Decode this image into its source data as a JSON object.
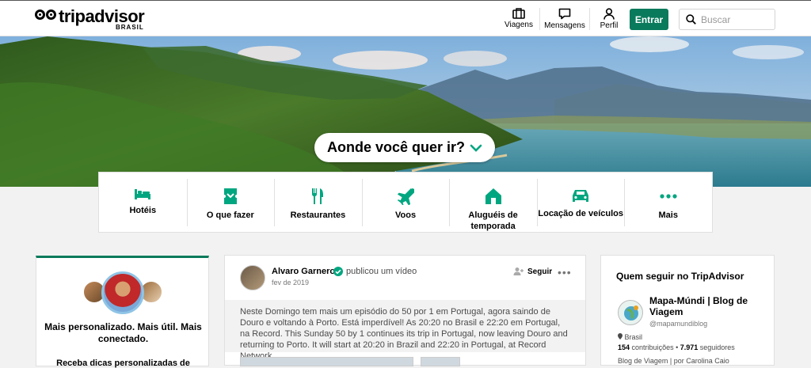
{
  "header": {
    "logo_text": "tripadvisor",
    "logo_sub": "BRASIL",
    "nav": [
      {
        "label": "Viagens",
        "icon": "suitcase-icon"
      },
      {
        "label": "Mensagens",
        "icon": "chat-icon"
      },
      {
        "label": "Perfil",
        "icon": "person-icon"
      }
    ],
    "login_label": "Entrar",
    "search_placeholder": "Buscar"
  },
  "hero": {
    "search_prompt": "Aonde você quer ir?"
  },
  "categories": [
    {
      "label": "Hotéis",
      "icon": "bed-icon"
    },
    {
      "label": "O que fazer",
      "icon": "ticket-icon"
    },
    {
      "label": "Restaurantes",
      "icon": "fork-knife-icon"
    },
    {
      "label": "Voos",
      "icon": "plane-icon"
    },
    {
      "label": "Aluguéis de temporada",
      "icon": "house-icon"
    },
    {
      "label": "Locação de veículos",
      "icon": "car-icon"
    },
    {
      "label": "Mais",
      "icon": "more-dots-icon"
    }
  ],
  "personalize_card": {
    "title": "Mais personalizado. Mais útil. Mais conectado.",
    "subtitle": "Receba dicas personalizadas de"
  },
  "post": {
    "author": "Alvaro Garnero",
    "action": "publicou um vídeo",
    "date": "fev de 2019",
    "follow_label": "Seguir",
    "text": "Neste Domingo tem mais um episódio do 50 por 1 em Portugal, agora saindo de Douro e voltando à Porto. Está imperdível! As 20:20 no Brasil e 22:20 em Portugal, na Record. This Sunday 50 by 1 continues its trip in Portugal, now leaving Douro and returning to Porto. It will start at 20:20 in Brazil and 22:20 in Portugal, at Record Network."
  },
  "follow_card": {
    "title": "Quem seguir no TripAdvisor",
    "rec_name": "Mapa-Múndi | Blog de Viagem",
    "rec_handle": "@mapamundiblog",
    "rec_location": "Brasil",
    "rec_contributions": "154",
    "rec_contributions_label": "contribuições",
    "rec_followers": "7.971",
    "rec_followers_label": "seguidores",
    "rec_desc": "Blog de Viagem | por Carolina Caio"
  },
  "colors": {
    "brand_green": "#0a7a5c",
    "icon_green": "#00a680"
  }
}
